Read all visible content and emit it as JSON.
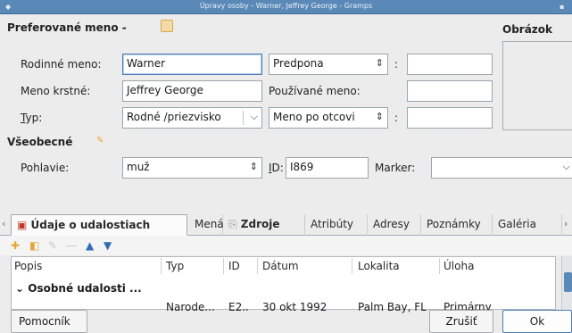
{
  "window": {
    "title": "Úpravy osoby - Warner, Jeffrey George - Gramps"
  },
  "preferred_name": {
    "section_label": "Preferované meno -",
    "surname_label": "Rodinné meno:",
    "surname_value": "Warner",
    "prefix_placeholder": "Predpona",
    "prefix_colon": ":",
    "prefix_value": "",
    "given_label": "Meno krstné:",
    "given_value": "Jeffrey George",
    "nickname_label": "Používané meno:",
    "nickname_value": "",
    "type_label": "Typ:",
    "type_value": "Rodné /priezvisko",
    "origin_value": "Meno po otcovi",
    "origin_colon": ":",
    "origin_extra": ""
  },
  "image": {
    "label": "Obrázok"
  },
  "general": {
    "section_label": "Všeobecné",
    "gender_label": "Pohlavie:",
    "gender_value": "muž",
    "id_label": "ID:",
    "id_value": "I869",
    "marker_label": "Marker:",
    "marker_value": ""
  },
  "tabs": [
    {
      "label": "Údaje o udalostiach"
    },
    {
      "label": "Mená"
    },
    {
      "label": "Zdroje"
    },
    {
      "label": "Atribúty"
    },
    {
      "label": "Adresy"
    },
    {
      "label": "Poznámky"
    },
    {
      "label": "Galéria"
    }
  ],
  "table": {
    "columns": [
      "Popis",
      "Typ",
      "ID",
      "Dátum",
      "Lokalita",
      "Úloha"
    ],
    "group": "Osobné udalosti ...",
    "rows": [
      {
        "popis": "",
        "typ": "Narode...",
        "id": "E2..",
        "datum": "30 okt 1992",
        "lokalita": "Palm Bay, FL",
        "uloha": "Primárny"
      }
    ]
  },
  "buttons": {
    "help": "Pomocník",
    "cancel": "Zrušiť",
    "ok": "Ok"
  },
  "colors": {
    "titlebar": "#5a89b8",
    "accent_red": "#c0392b",
    "accent_blue": "#2f6db5",
    "icon_orange": "#e7a33a"
  }
}
